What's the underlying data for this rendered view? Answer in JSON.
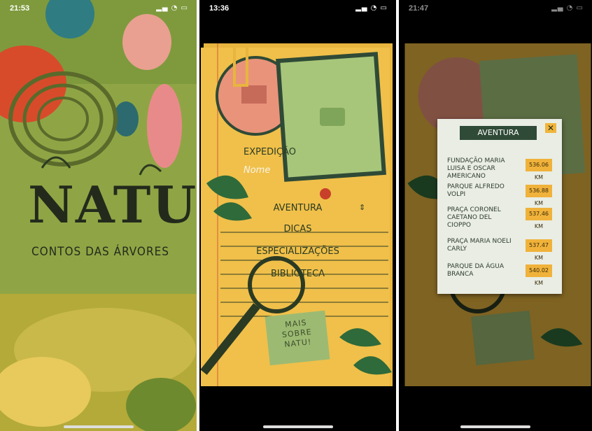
{
  "screens": [
    {
      "status": {
        "time": "21:53"
      },
      "splash": {
        "title": "NATU",
        "subtitle": "CONTOS DAS ÁRVORES"
      }
    },
    {
      "status": {
        "time": "13:36"
      },
      "menu": {
        "expedicao_label": "EXPEDIÇÃO",
        "nome_label": "Nome",
        "items": [
          "AVENTURA",
          "DICAS",
          "ESPECIALIZAÇÕES",
          "BIBLIOTECA"
        ],
        "dropdown_icon": "updown-arrows-icon",
        "about_button": [
          "MAIS",
          "SOBRE",
          "NATU!"
        ]
      }
    },
    {
      "status": {
        "time": "21:47"
      },
      "popup": {
        "title": "AVENTURA",
        "close_label": "✕",
        "places": [
          {
            "name": "FUNDAÇÃO MARIA LUISA E OSCAR AMERICANO",
            "distance": "536.06 KM"
          },
          {
            "name": "PARQUE ALFREDO VOLPI",
            "distance": "536.88 KM"
          },
          {
            "name": "PRAÇA CORONEL CAETANO DEL CIOPPO",
            "distance": "537.46 KM"
          },
          {
            "name": "PRAÇA MARIA NOELI CARLY",
            "distance": "537.47 KM"
          },
          {
            "name": "PARQUE DA ÁGUA BRANCA",
            "distance": "540.02 KM"
          }
        ]
      }
    }
  ],
  "colors": {
    "notebook": "#e8b53e",
    "dark_green": "#2f4a36",
    "light_green": "#9dba72",
    "accent_orange": "#f0b23a"
  }
}
